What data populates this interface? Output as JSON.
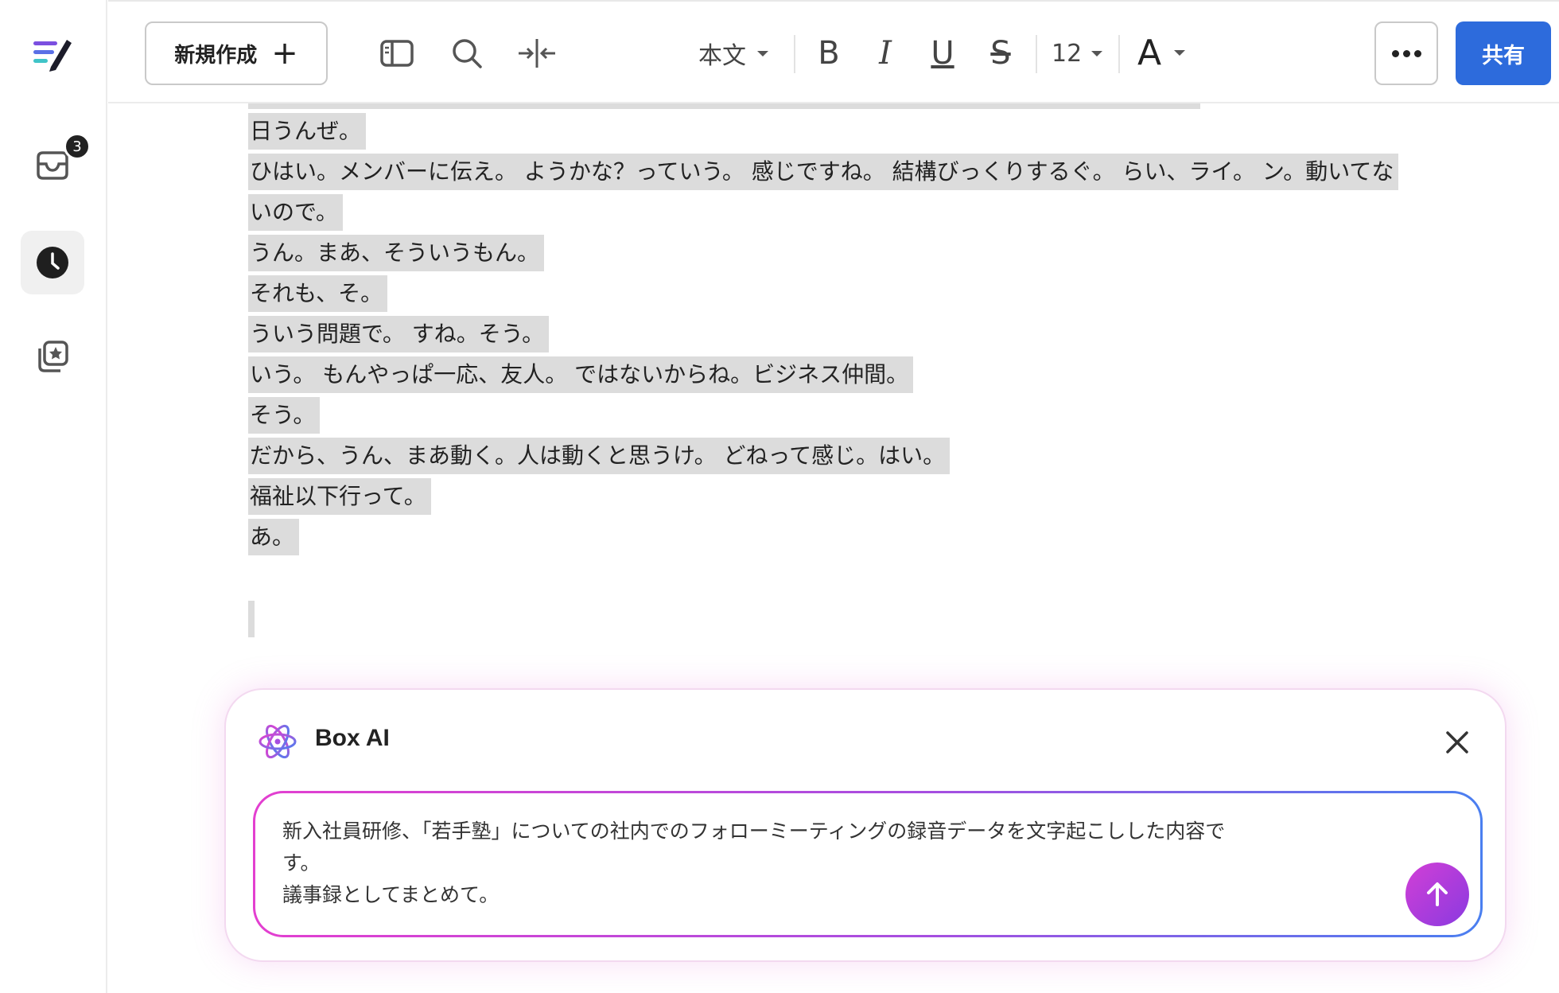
{
  "rail": {
    "inbox_badge": "3"
  },
  "toolbar": {
    "new_label": "新規作成",
    "new_plus": "+",
    "style_value": "本文",
    "bold": "B",
    "italic": "I",
    "underline": "U",
    "strike": "S",
    "font_size": "12",
    "text_color": "A",
    "share_label": "共有"
  },
  "document": {
    "lines": [
      "日うんぜ。",
      "ひはい。メンバーに伝え。 ようかな？っていう。 感じですね。 結構びっくりするぐ。 らい、ライ。 ン。動いてな",
      "いので。",
      "うん。まあ、そういうもん。",
      "それも、そ。",
      "ういう問題で。 すね。そう。",
      "いう。 もんやっぱ一応、友人。 ではないからね。ビジネス仲間。",
      "そう。",
      "だから、うん、まあ動く。人は動くと思うけ。 どねって感じ。はい。",
      "福祉以下行って。",
      "あ。"
    ]
  },
  "ai": {
    "title": "Box AI",
    "prompt": "新入社員研修、「若手塾」についての社内でのフォローミーティングの録音データを文字起こしした内容で\nす。\n議事録としてまとめて。"
  },
  "colors": {
    "share_bg": "#2d6bdc",
    "highlight": "#dcdcdc",
    "ai_gradient_start": "#e33fd0",
    "ai_gradient_end": "#4a7ff0"
  },
  "icons": [
    "app-logo-icon",
    "inbox-icon",
    "clock-icon",
    "favorites-icon",
    "sidebar-toggle-icon",
    "search-icon",
    "collapse-width-icon",
    "box-ai-icon",
    "close-icon",
    "arrow-up-icon"
  ]
}
